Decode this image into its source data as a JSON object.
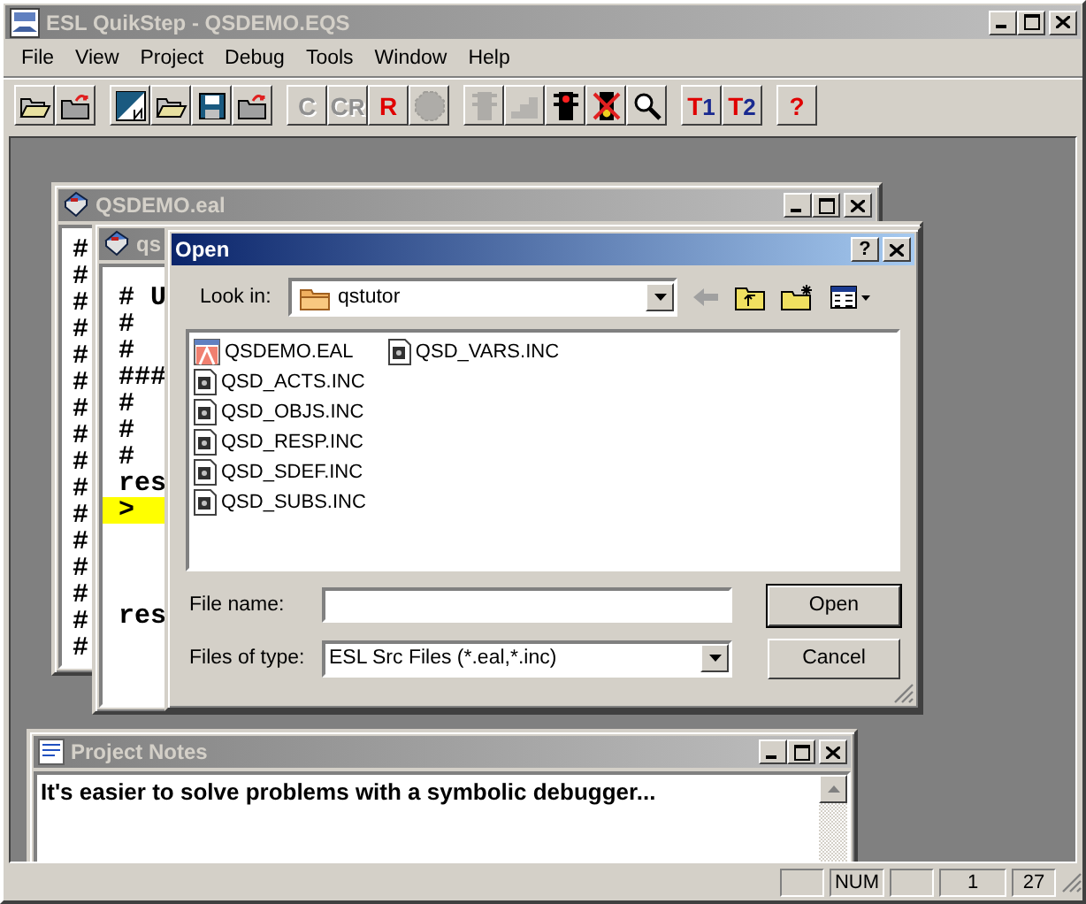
{
  "window": {
    "title": "ESL QuikStep - QSDEMO.EQS"
  },
  "menu": [
    {
      "label": "File"
    },
    {
      "label": "View"
    },
    {
      "label": "Project"
    },
    {
      "label": "Debug"
    },
    {
      "label": "Tools"
    },
    {
      "label": "Window"
    },
    {
      "label": "Help"
    }
  ],
  "toolbar": [
    {
      "buttons": [
        {
          "kind": "open-folder",
          "disabled": false
        },
        {
          "kind": "close-folder",
          "disabled": false
        }
      ]
    },
    {
      "buttons": [
        {
          "kind": "new-file",
          "disabled": false
        },
        {
          "kind": "open-folder",
          "disabled": false
        },
        {
          "kind": "save",
          "disabled": false
        },
        {
          "kind": "close-folder",
          "disabled": false
        }
      ]
    },
    {
      "buttons": [
        {
          "kind": "letter",
          "label": "C",
          "disabled": true
        },
        {
          "kind": "letter",
          "label": "CR",
          "disabled": true
        },
        {
          "kind": "letter",
          "label": "R",
          "disabled": false
        },
        {
          "kind": "stop",
          "disabled": true
        }
      ]
    },
    {
      "buttons": [
        {
          "kind": "traffic-light",
          "disabled": true
        },
        {
          "kind": "steps",
          "disabled": true
        },
        {
          "kind": "traffic-light",
          "disabled": false
        },
        {
          "kind": "traffic-light-x",
          "disabled": false
        },
        {
          "kind": "magnifier",
          "disabled": false
        }
      ]
    },
    {
      "buttons": [
        {
          "kind": "letter",
          "label": "T1",
          "disabled": false
        },
        {
          "kind": "letter",
          "label": "T2",
          "disabled": false
        }
      ]
    },
    {
      "buttons": [
        {
          "kind": "letter",
          "label": "?",
          "disabled": false
        }
      ]
    }
  ],
  "editor_back": {
    "title": "QSDEMO.eal",
    "lines": [
      "#",
      "#",
      "#",
      "#",
      "#",
      "#",
      "#",
      "#",
      "#",
      "#",
      "#",
      "#",
      "#",
      "#",
      "#",
      "#"
    ]
  },
  "editor_front": {
    "title": "qs",
    "lines": [
      {
        "text": "# U",
        "current": false
      },
      {
        "text": "#",
        "current": false
      },
      {
        "text": "#",
        "current": false
      },
      {
        "text": "###",
        "current": false
      },
      {
        "text": "#",
        "current": false
      },
      {
        "text": "#",
        "current": false
      },
      {
        "text": "#",
        "current": false
      },
      {
        "text": "res",
        "current": false
      },
      {
        "text": ">",
        "current": true
      },
      {
        "current": false
      },
      {
        "current": false
      },
      {
        "current": false
      },
      {
        "text": "res",
        "current": false
      }
    ]
  },
  "open_dialog": {
    "title": "Open",
    "help_button": "?",
    "look_in_label": "Look in:",
    "look_in": "qstutor",
    "files": [
      {
        "name": "QSDEMO.EAL",
        "kind": "eal",
        "selected": false
      },
      {
        "name": "QSD_ACTS.INC",
        "kind": "inc",
        "selected": false
      },
      {
        "name": "QSD_OBJS.INC",
        "kind": "inc",
        "selected": false
      },
      {
        "name": "QSD_RESP.INC",
        "kind": "inc",
        "selected": false
      },
      {
        "name": "QSD_SDEF.INC",
        "kind": "inc",
        "selected": false
      },
      {
        "name": "QSD_SUBS.INC",
        "kind": "inc",
        "selected": false
      },
      {
        "name": "QSD_VARS.INC",
        "kind": "inc",
        "selected": false
      }
    ],
    "file_name_label": "File name:",
    "file_type_label": "Files of type:",
    "file_type": "ESL Src Files (*.eal,*.inc)",
    "open_button": "Open",
    "cancel_button": "Cancel"
  },
  "project_notes": {
    "title": "Project Notes",
    "text": "It's easier to solve problems with a symbolic debugger..."
  },
  "status_bar": [
    {
      "kind": "blank"
    },
    {
      "kind": "text",
      "text": "NUM"
    },
    {
      "kind": "blank"
    },
    {
      "kind": "text",
      "text": "1"
    },
    {
      "kind": "text",
      "text": "27"
    }
  ]
}
